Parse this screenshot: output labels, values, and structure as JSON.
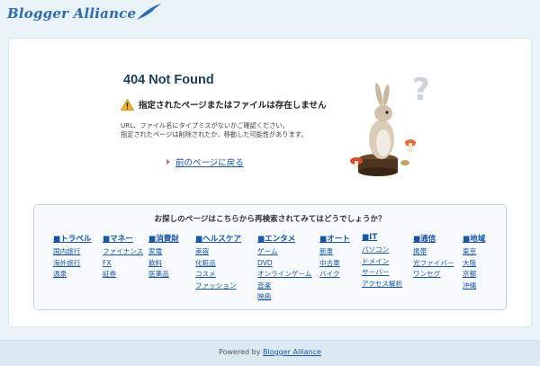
{
  "header": {
    "logo_text": "Blogger Alliance"
  },
  "error": {
    "title": "404 Not Found",
    "warning": "指定されたページまたはファイルは存在しません",
    "desc_line1": "URL、ファイル名にタイプミスがないかご確認ください。",
    "desc_line2": "指定されたページは削除されたか、移動した可能性があります。",
    "back_link": "前のページに戻る"
  },
  "search": {
    "title": "お探しのページはこちらから再検索されてみてはどうでしょうか？",
    "categories": [
      {
        "name": "■トラベル",
        "items": [
          "国内旅行",
          "海外旅行",
          "温泉"
        ]
      },
      {
        "name": "■マネー",
        "items": [
          "ファイナンス",
          "FX",
          "証券"
        ]
      },
      {
        "name": "■消費財",
        "items": [
          "家電",
          "飲料",
          "医薬品"
        ]
      },
      {
        "name": "■ヘルスケア",
        "items": [
          "美容",
          "化粧品",
          "コスメ",
          "ファッション"
        ]
      },
      {
        "name": "■エンタメ",
        "items": [
          "ゲーム",
          "DVD",
          "オンラインゲーム",
          "音楽",
          "映画"
        ]
      },
      {
        "name": "■オート",
        "items": [
          "新車",
          "中古車",
          "バイク"
        ]
      },
      {
        "name": "■IT",
        "items": [
          "パソコン",
          "ドメイン",
          "サーバー",
          "アクセス解析"
        ]
      },
      {
        "name": "■通信",
        "items": [
          "携帯",
          "光ファイバー",
          "ワンセグ"
        ]
      },
      {
        "name": "■地域",
        "items": [
          "東京",
          "大阪",
          "京都",
          "沖縄"
        ]
      }
    ]
  },
  "footer": {
    "powered_by": "Powered by",
    "link": "Blogger Alliance"
  },
  "colors": {
    "accent": "#2c6bb5",
    "link": "#1a55a8",
    "background": "#eaf3f8"
  }
}
